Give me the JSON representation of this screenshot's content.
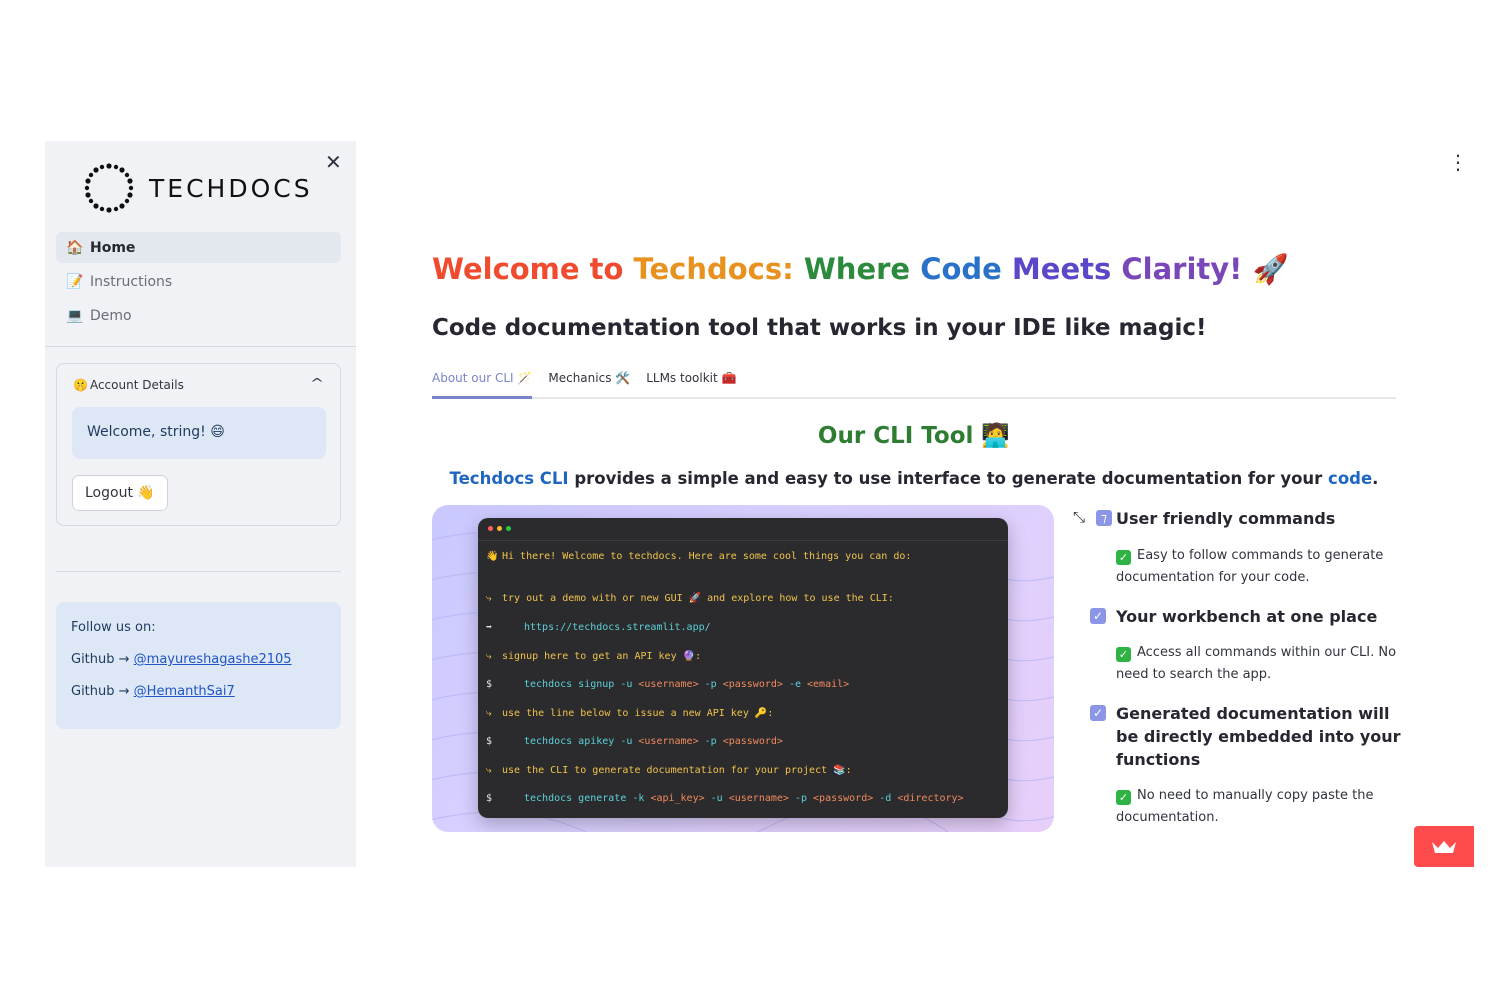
{
  "sidebar": {
    "logo_text": "TECHDOCS",
    "nav": [
      {
        "emoji": "🏠",
        "label": "Home",
        "active": true
      },
      {
        "emoji": "📝",
        "label": "Instructions",
        "active": false
      },
      {
        "emoji": "💻",
        "label": "Demo",
        "active": false
      }
    ],
    "account": {
      "emoji": "🤫",
      "header": "Account Details",
      "welcome": "Welcome, string! 😄",
      "logout": "Logout 👋"
    },
    "follow": {
      "title": "Follow us on:",
      "links": [
        {
          "prefix": "Github → ",
          "handle": "@mayureshagashe2105"
        },
        {
          "prefix": "Github → ",
          "handle": "@HemanthSai7"
        }
      ]
    }
  },
  "main": {
    "title_parts": [
      "Welcome to ",
      "Techdocs: ",
      "Where ",
      "Code ",
      "Meets ",
      "Clarity! "
    ],
    "title_emoji": "🚀",
    "subtitle": "Code documentation tool that works in your IDE like magic!",
    "tabs": [
      {
        "label": "About our CLI 🪄",
        "active": true
      },
      {
        "label": "Mechanics 🛠️",
        "active": false
      },
      {
        "label": "LLMs toolkit 🧰",
        "active": false
      }
    ],
    "section_title": "Our CLI Tool 🧑‍💻",
    "section_desc": {
      "a": "Techdocs CLI",
      "b": " provides a simple and easy to use interface to generate documentation for your ",
      "c": "code",
      "d": "."
    },
    "terminal": {
      "l1": "Hi there! Welcome to techdocs. Here are some cool things you can do:",
      "l2a": "try out a demo with or new GUI",
      "l2b": "and explore how to use the CLI:",
      "l3": "https://techdocs.streamlit.app/",
      "l4": "signup here to get an API key",
      "l5a": "techdocs signup -u ",
      "l5b": "<username>",
      "l5c": " -p ",
      "l5d": "<password>",
      "l5e": " -e ",
      "l5f": "<email>",
      "l6": "use the line below to issue a new API key",
      "l7a": "techdocs apikey -u ",
      "l7b": "<username>",
      "l7c": " -p ",
      "l7d": "<password>",
      "l8": "use the CLI to generate documentation for your project",
      "l9a": "techdocs generate -k ",
      "l9b": "<api_key>",
      "l9c": " -u ",
      "l9d": "<username>",
      "l9e": " -p ",
      "l9f": "<password>",
      "l9g": " -d ",
      "l9h": "<directory>"
    },
    "features": [
      {
        "title": "User friendly commands",
        "desc": "Easy to follow commands to generate documentation for your code."
      },
      {
        "title": "Your workbench at one place",
        "desc": "Access all commands within our CLI. No need to search the app."
      },
      {
        "title": "Generated documentation will be directly embedded into your functions",
        "desc": "No need to manually copy paste the documentation."
      }
    ]
  },
  "colors": {
    "accent": "#7b84c9",
    "streamlit_red": "#ff4b4b",
    "heading_green": "#2f7d32"
  }
}
